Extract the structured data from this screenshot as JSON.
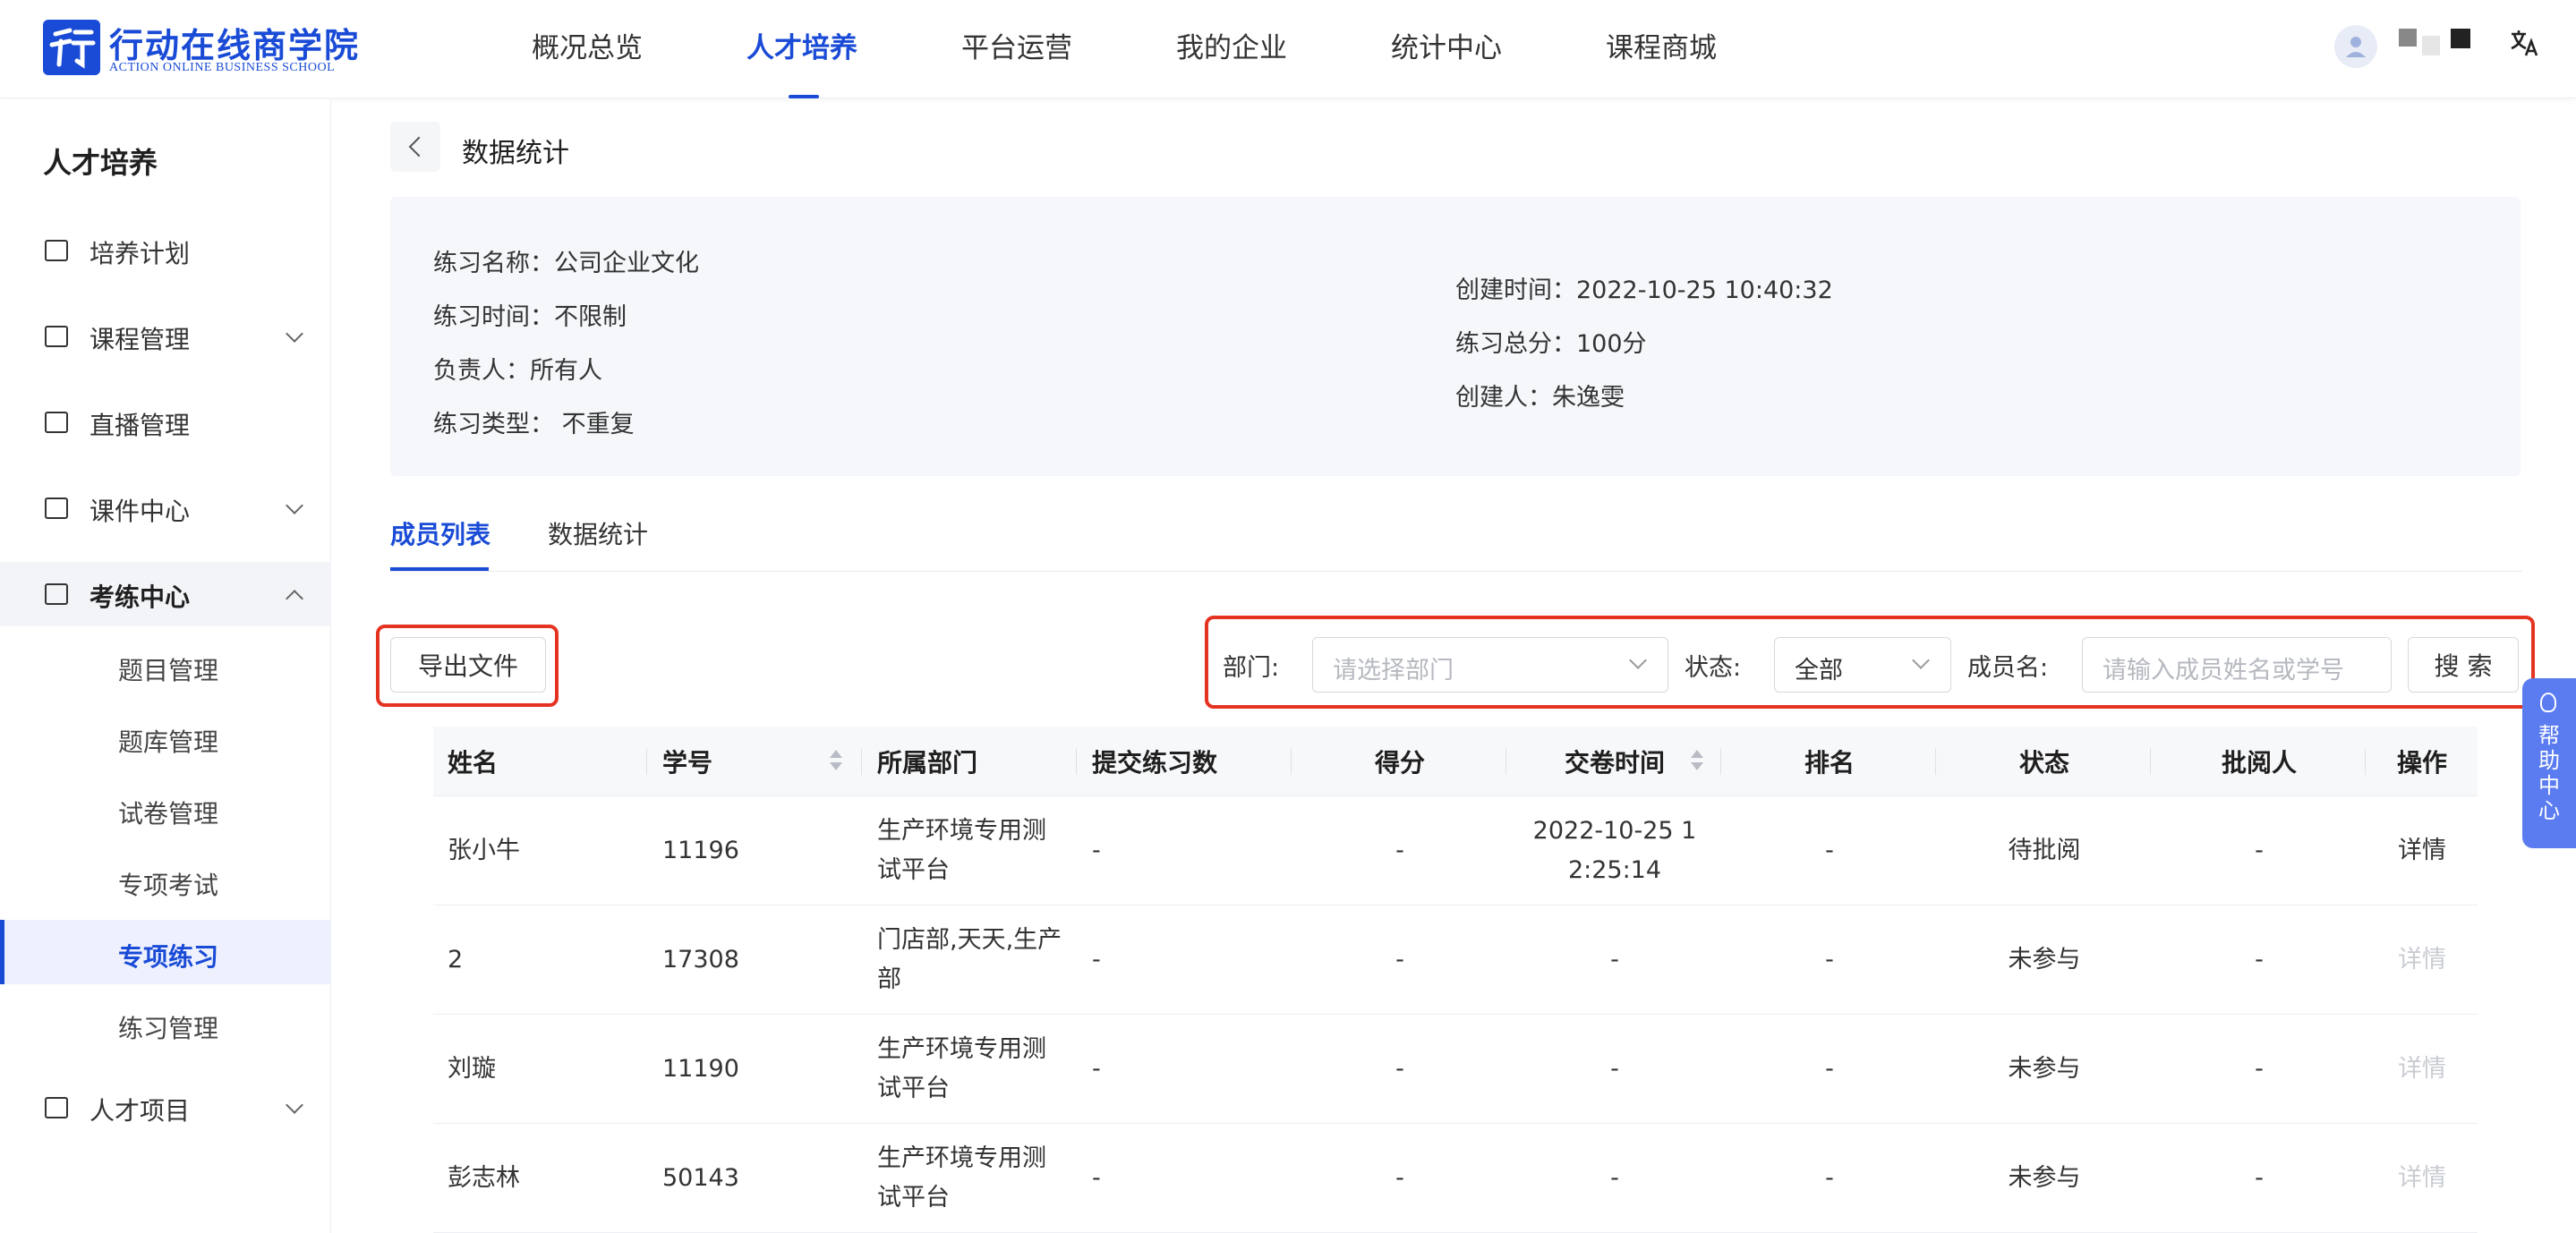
{
  "header": {
    "logo_title": "行动在线商学院",
    "logo_subtitle": "ACTION ONLINE BUSINESS SCHOOL",
    "nav": [
      "概况总览",
      "人才培养",
      "平台运营",
      "我的企业",
      "统计中心",
      "课程商城"
    ],
    "active_nav_index": 1,
    "lang_icon": "translate-icon",
    "accent_color": "#1a4bd6"
  },
  "sidebar": {
    "title": "人才培养",
    "items": [
      {
        "label": "培养计划",
        "icon": "calendar-icon"
      },
      {
        "label": "课程管理",
        "icon": "book-icon"
      },
      {
        "label": "直播管理",
        "icon": "video-icon"
      },
      {
        "label": "课件中心",
        "icon": "inbox-icon"
      },
      {
        "label": "考练中心",
        "icon": "exam-icon"
      },
      {
        "label": "人才项目",
        "icon": "project-icon"
      }
    ],
    "sub_items": [
      "题目管理",
      "题库管理",
      "试卷管理",
      "专项考试",
      "专项练习",
      "练习管理"
    ],
    "active_sub_index": 4
  },
  "page": {
    "title": "数据统计",
    "info": {
      "name": "练习名称：公司企业文化",
      "time": "练习时间：不限制",
      "owner": "负责人：所有人",
      "type": "练习类型： 不重复",
      "created_at": "创建时间：2022-10-25 10:40:32",
      "total_score": "练习总分：100分",
      "creator": "创建人：朱逸雯"
    },
    "tabs": [
      "成员列表",
      "数据统计"
    ],
    "active_tab_index": 0
  },
  "toolbar": {
    "export_label": "导出文件",
    "dept_label": "部门:",
    "dept_placeholder": "请选择部门",
    "status_label": "状态:",
    "status_value": "全部",
    "member_label": "成员名:",
    "member_placeholder": "请输入成员姓名或学号",
    "search_label": "搜 索",
    "highlight_color": "#e53322"
  },
  "table": {
    "columns": [
      "姓名",
      "学号",
      "所属部门",
      "提交练习数",
      "得分",
      "交卷时间",
      "排名",
      "状态",
      "批阅人",
      "操作"
    ],
    "rows": [
      {
        "name": "张小牛",
        "id": "11196",
        "dept": "生产环境专用测试平台",
        "submits": "-",
        "score": "-",
        "submit_time": "2022-10-25 12:25:14",
        "rank": "-",
        "status": "待批阅",
        "reviewer": "-",
        "action": "详情",
        "action_enabled": true
      },
      {
        "name": "2",
        "id": "17308",
        "dept": "门店部,天天,生产部",
        "submits": "-",
        "score": "-",
        "submit_time": "-",
        "rank": "-",
        "status": "未参与",
        "reviewer": "-",
        "action": "详情",
        "action_enabled": false
      },
      {
        "name": "刘璇",
        "id": "11190",
        "dept": "生产环境专用测试平台",
        "submits": "-",
        "score": "-",
        "submit_time": "-",
        "rank": "-",
        "status": "未参与",
        "reviewer": "-",
        "action": "详情",
        "action_enabled": false
      },
      {
        "name": "彭志林",
        "id": "50143",
        "dept": "生产环境专用测试平台",
        "submits": "-",
        "score": "-",
        "submit_time": "-",
        "rank": "-",
        "status": "未参与",
        "reviewer": "-",
        "action": "详情",
        "action_enabled": false
      }
    ]
  },
  "help": {
    "label": "帮助中心",
    "icon": "lightbulb-icon"
  }
}
